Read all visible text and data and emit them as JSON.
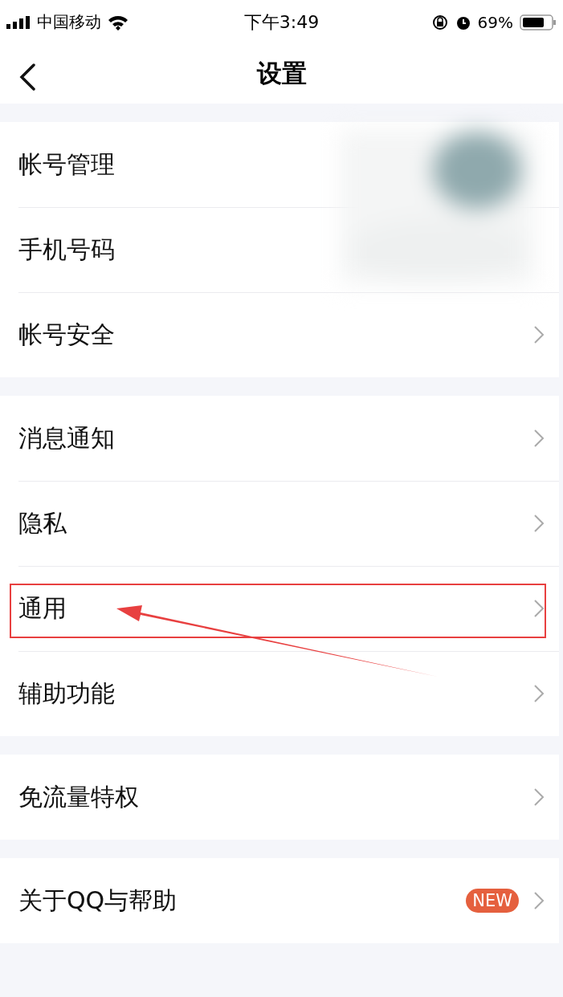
{
  "status_bar": {
    "carrier": "中国移动",
    "time": "下午3:49",
    "battery": "69%"
  },
  "nav": {
    "title": "设置"
  },
  "groups": [
    {
      "items": [
        {
          "label": "帐号管理",
          "chevron": false,
          "highlighted": false
        },
        {
          "label": "手机号码",
          "chevron": false,
          "highlighted": false
        },
        {
          "label": "帐号安全",
          "chevron": true,
          "highlighted": false
        }
      ],
      "overlay": {
        "kind": "picture"
      }
    },
    {
      "items": [
        {
          "label": "消息通知",
          "chevron": true,
          "highlighted": false
        },
        {
          "label": "隐私",
          "chevron": true,
          "highlighted": false
        },
        {
          "label": "通用",
          "chevron": true,
          "highlighted": true
        },
        {
          "label": "辅助功能",
          "chevron": true,
          "highlighted": false
        }
      ]
    },
    {
      "items": [
        {
          "label": "免流量特权",
          "chevron": true,
          "highlighted": false
        }
      ]
    },
    {
      "items": [
        {
          "label": "关于QQ与帮助",
          "badge": "NEW",
          "chevron": true,
          "highlighted": false
        }
      ]
    }
  ]
}
